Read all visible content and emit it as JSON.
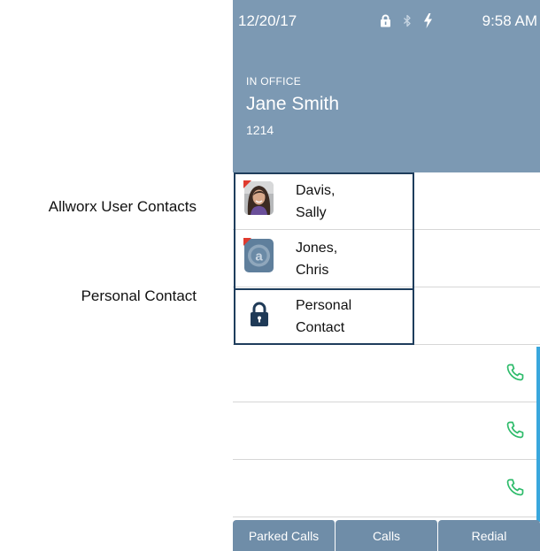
{
  "callouts": {
    "user_contacts": "Allworx User Contacts",
    "personal_contact": "Personal Contact"
  },
  "status": {
    "date": "12/20/17",
    "time": "9:58 AM",
    "icons": [
      "lock-icon",
      "bluetooth-icon",
      "lightning-icon"
    ]
  },
  "header": {
    "presence": "IN OFFICE",
    "name": "Jane Smith",
    "extension": "1214"
  },
  "contacts": [
    {
      "line1": "Davis,",
      "line2": "Sally",
      "type": "allworx-user",
      "avatar": "photo-avatar"
    },
    {
      "line1": "Jones,",
      "line2": "Chris",
      "type": "allworx-user",
      "avatar": "allworx-logo-avatar"
    },
    {
      "line1": "Personal",
      "line2": "Contact",
      "type": "personal",
      "avatar": "lock-icon"
    }
  ],
  "colors": {
    "header_bg": "#7c99b3",
    "tab_bg": "#6f8da8",
    "call_icon": "#2dbb6a",
    "scroll_indicator": "#39a7dd",
    "outline": "#1e3d5c",
    "flag": "#e03a2e"
  },
  "tabs": [
    "Parked Calls",
    "Calls",
    "Redial"
  ]
}
